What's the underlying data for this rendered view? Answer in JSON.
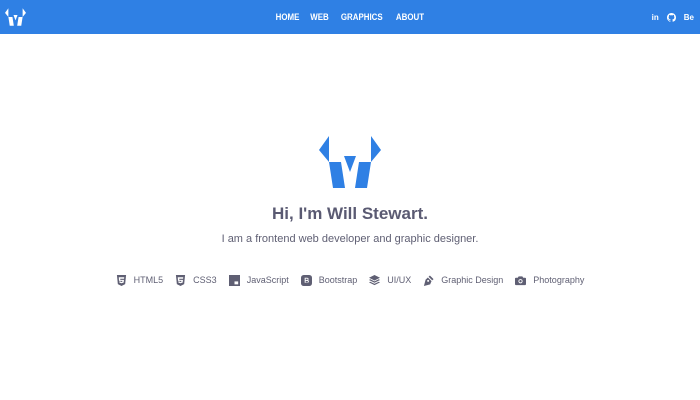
{
  "nav": {
    "brand_icon": "w-logo-icon",
    "links": [
      {
        "label": "HOME"
      },
      {
        "label": "WEB"
      },
      {
        "label": "GRAPHICS"
      },
      {
        "label": "ABOUT"
      }
    ],
    "social": [
      {
        "label": "in",
        "icon": "linkedin-icon"
      },
      {
        "label": "",
        "icon": "github-icon"
      },
      {
        "label": "Be",
        "icon": "behance-icon"
      }
    ]
  },
  "hero": {
    "logo_icon": "w-logo-icon",
    "headline": "Hi, I'm Will Stewart.",
    "tagline": "I am a frontend web developer and graphic designer."
  },
  "skills": [
    {
      "label": "HTML5",
      "icon": "html5-icon"
    },
    {
      "label": "CSS3",
      "icon": "css3-icon"
    },
    {
      "label": "JavaScript",
      "icon": "javascript-icon"
    },
    {
      "label": "Bootstrap",
      "icon": "bootstrap-icon"
    },
    {
      "label": "UI/UX",
      "icon": "layers-icon"
    },
    {
      "label": "Graphic Design",
      "icon": "pen-icon"
    },
    {
      "label": "Photography",
      "icon": "camera-icon"
    }
  ],
  "colors": {
    "navbar": "#2f80e4",
    "accent": "#2f80e4",
    "text": "#5f5f73",
    "headline": "#5a5a72"
  }
}
